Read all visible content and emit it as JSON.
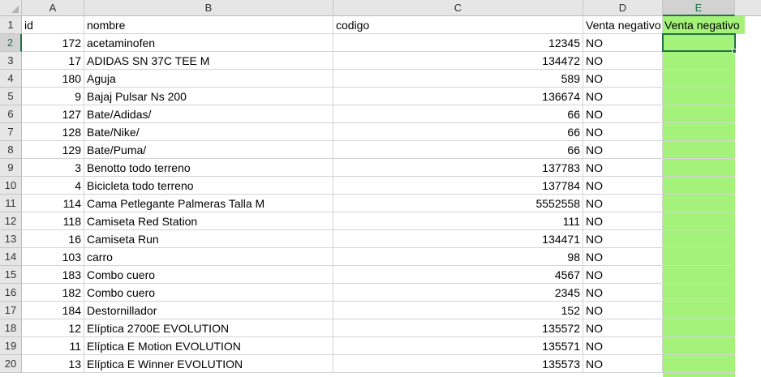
{
  "columns": [
    "A",
    "B",
    "C",
    "D",
    "E"
  ],
  "selected_column": "E",
  "selected_row": "2",
  "colors": {
    "fill": "#a4f27a",
    "accent": "#217346"
  },
  "header_row": {
    "row_number": "1",
    "id": "id",
    "nombre": "nombre",
    "codigo": "codigo",
    "venta_d": "Venta negativo",
    "venta_e": "Venta negativo"
  },
  "rows": [
    {
      "row_number": "2",
      "id": "172",
      "nombre": "acetaminofen",
      "codigo": "12345",
      "venta": "NO"
    },
    {
      "row_number": "3",
      "id": "17",
      "nombre": "ADIDAS SN 37C TEE M",
      "codigo": "134472",
      "venta": "NO"
    },
    {
      "row_number": "4",
      "id": "180",
      "nombre": "Aguja",
      "codigo": "589",
      "venta": "NO"
    },
    {
      "row_number": "5",
      "id": "9",
      "nombre": "Bajaj Pulsar Ns 200",
      "codigo": "136674",
      "venta": "NO"
    },
    {
      "row_number": "6",
      "id": "127",
      "nombre": "Bate/Adidas/",
      "codigo": "66",
      "venta": "NO"
    },
    {
      "row_number": "7",
      "id": "128",
      "nombre": "Bate/Nike/",
      "codigo": "66",
      "venta": "NO"
    },
    {
      "row_number": "8",
      "id": "129",
      "nombre": "Bate/Puma/",
      "codigo": "66",
      "venta": "NO"
    },
    {
      "row_number": "9",
      "id": "3",
      "nombre": "Benotto todo terreno",
      "codigo": "137783",
      "venta": "NO"
    },
    {
      "row_number": "10",
      "id": "4",
      "nombre": "Bicicleta todo terreno",
      "codigo": "137784",
      "venta": "NO"
    },
    {
      "row_number": "11",
      "id": "114",
      "nombre": "Cama Petlegante Palmeras Talla M",
      "codigo": "5552558",
      "venta": "NO"
    },
    {
      "row_number": "12",
      "id": "118",
      "nombre": "Camiseta Red Station",
      "codigo": "111",
      "venta": "NO"
    },
    {
      "row_number": "13",
      "id": "16",
      "nombre": "Camiseta Run",
      "codigo": "134471",
      "venta": "NO"
    },
    {
      "row_number": "14",
      "id": "103",
      "nombre": "carro",
      "codigo": "98",
      "venta": "NO"
    },
    {
      "row_number": "15",
      "id": "183",
      "nombre": "Combo cuero",
      "codigo": "4567",
      "venta": "NO"
    },
    {
      "row_number": "16",
      "id": "182",
      "nombre": "Combo cuero",
      "codigo": "2345",
      "venta": "NO"
    },
    {
      "row_number": "17",
      "id": "184",
      "nombre": "Destornillador",
      "codigo": "152",
      "venta": "NO"
    },
    {
      "row_number": "18",
      "id": "12",
      "nombre": "Elíptica 2700E EVOLUTION",
      "codigo": "135572",
      "venta": "NO"
    },
    {
      "row_number": "19",
      "id": "11",
      "nombre": "Elíptica E Motion EVOLUTION",
      "codigo": "135571",
      "venta": "NO"
    },
    {
      "row_number": "20",
      "id": "13",
      "nombre": "Elíptica E Winner EVOLUTION",
      "codigo": "135573",
      "venta": "NO"
    }
  ]
}
